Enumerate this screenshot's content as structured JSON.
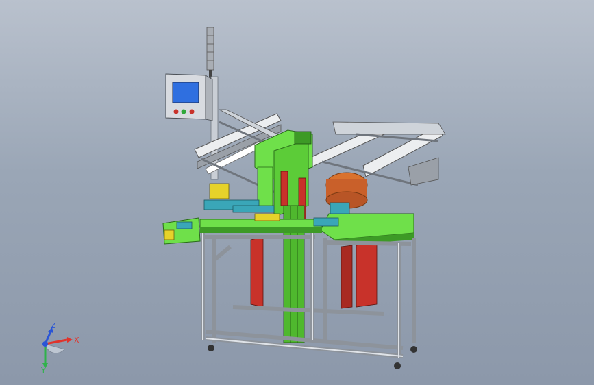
{
  "viewport": {
    "background_top": "#b9c1cd",
    "background_bottom": "#8c98aa"
  },
  "model": {
    "description_icon": "automation-assembly-machine-icon",
    "colors": {
      "frame": "#cfd4da",
      "frame_dark": "#7c838c",
      "green": "#6fe04a",
      "green_dark": "#3d9a26",
      "red": "#c8322a",
      "orange": "#d9722e",
      "teal": "#3aa6b8",
      "yellow": "#e6d22a",
      "screen": "#2f6fe0",
      "panel": "#d8dbe0"
    }
  },
  "triad": {
    "x_label": "X",
    "y_label": "Y",
    "z_label": "Z",
    "colors": {
      "x": "#e0342c",
      "y": "#2fb24a",
      "z": "#2a55d6"
    }
  }
}
